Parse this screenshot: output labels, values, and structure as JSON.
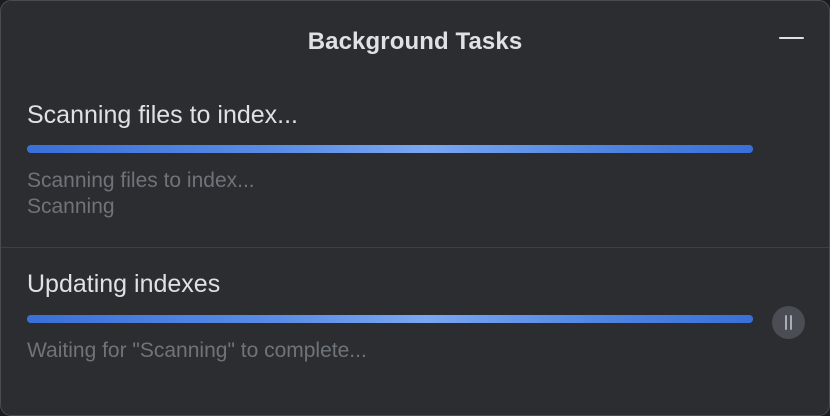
{
  "window": {
    "title": "Background Tasks"
  },
  "tasks": [
    {
      "title": "Scanning files to index...",
      "progress": 1.0,
      "status_lines": [
        "Scanning files to index...",
        "Scanning"
      ],
      "pausable": false
    },
    {
      "title": "Updating indexes",
      "progress": 1.0,
      "status_lines": [
        "Waiting for \"Scanning\" to complete..."
      ],
      "pausable": true,
      "pause_icon": "pause-icon"
    }
  ],
  "colors": {
    "background": "#2b2d30",
    "progress": "#4a7fd9",
    "text_primary": "#dfe1e5",
    "text_secondary": "#6f737a"
  }
}
